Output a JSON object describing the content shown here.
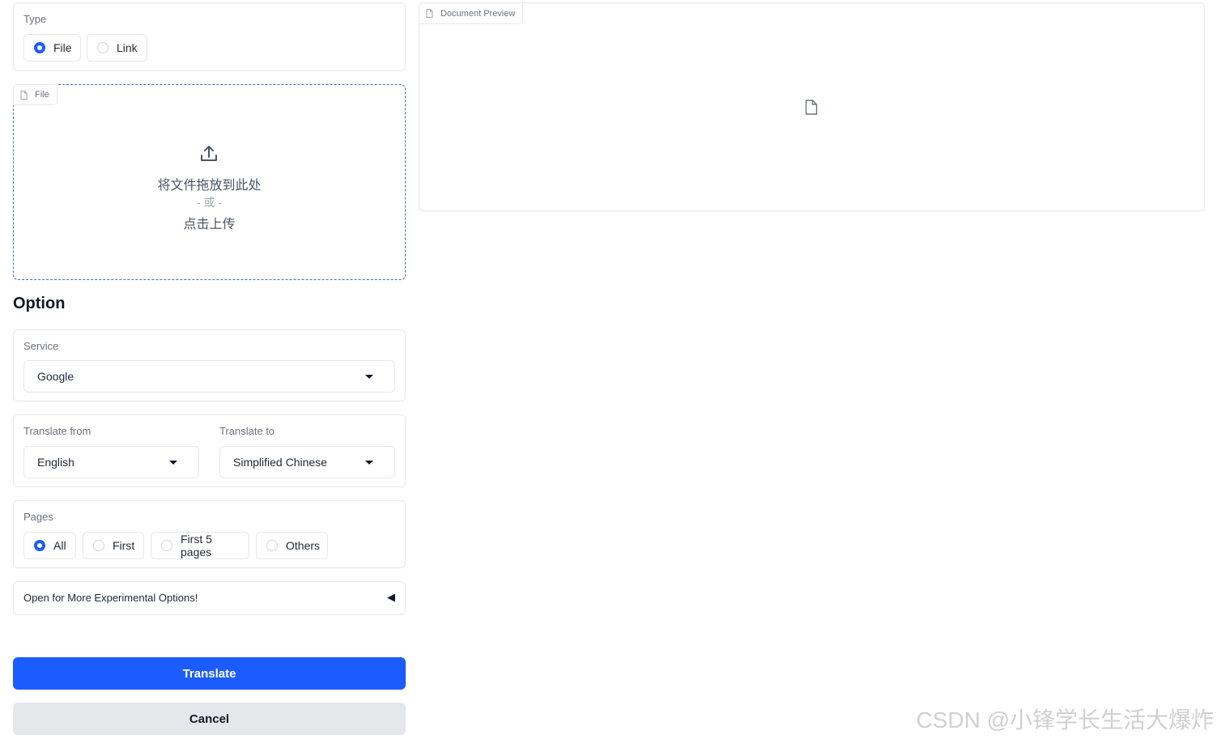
{
  "type_block": {
    "label": "Type",
    "options": [
      {
        "label": "File",
        "checked": true
      },
      {
        "label": "Link",
        "checked": false
      }
    ]
  },
  "file_upload": {
    "tag": "File",
    "drop_text": "将文件拖放到此处",
    "or_text": "- 或 -",
    "click_text": "点击上传",
    "icon": "upload-icon"
  },
  "preview": {
    "tag": "Document Preview",
    "icon": "file-icon"
  },
  "option": {
    "heading": "Option",
    "service": {
      "label": "Service",
      "value": "Google"
    },
    "translate_from": {
      "label": "Translate from",
      "value": "English"
    },
    "translate_to": {
      "label": "Translate to",
      "value": "Simplified Chinese"
    },
    "pages": {
      "label": "Pages",
      "options": [
        {
          "label": "All",
          "checked": true
        },
        {
          "label": "First",
          "checked": false
        },
        {
          "label": "First 5 pages",
          "checked": false
        },
        {
          "label": "Others",
          "checked": false
        }
      ]
    },
    "experimental": {
      "label": "Open for More Experimental Options!",
      "arrow": "◀"
    }
  },
  "buttons": {
    "translate": "Translate",
    "cancel": "Cancel"
  },
  "watermark": "CSDN @小锋学长生活大爆炸",
  "colors": {
    "accent": "#1b5cff",
    "dashed_border": "#4b6fb5",
    "secondary_button": "#e5e7eb"
  }
}
